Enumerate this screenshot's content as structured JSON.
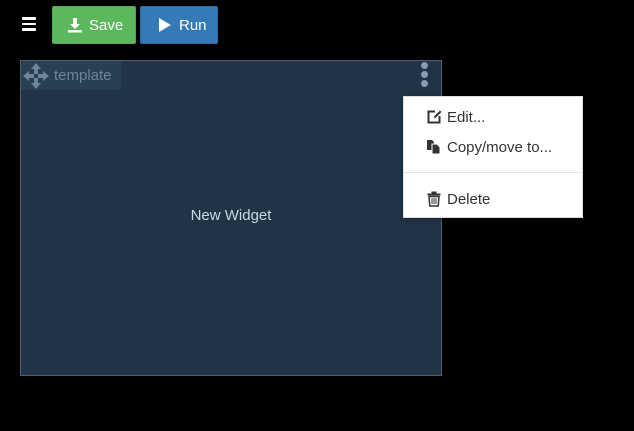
{
  "toolbar": {
    "menu_icon": "hamburger-icon",
    "save_label": "Save",
    "save_icon": "download-icon",
    "run_label": "Run",
    "run_icon": "play-icon",
    "save_color": "#5cb85c",
    "run_color": "#337ab7"
  },
  "widget": {
    "template_name": "template",
    "move_icon": "move-arrows-icon",
    "options_icon": "kebab-menu-icon",
    "body_text": "New Widget",
    "background": "#213345"
  },
  "context_menu": {
    "items": [
      {
        "label": "Edit...",
        "icon": "edit-icon"
      },
      {
        "label": "Copy/move to...",
        "icon": "copy-icon"
      },
      {
        "label": "Delete",
        "icon": "trash-icon"
      }
    ]
  }
}
